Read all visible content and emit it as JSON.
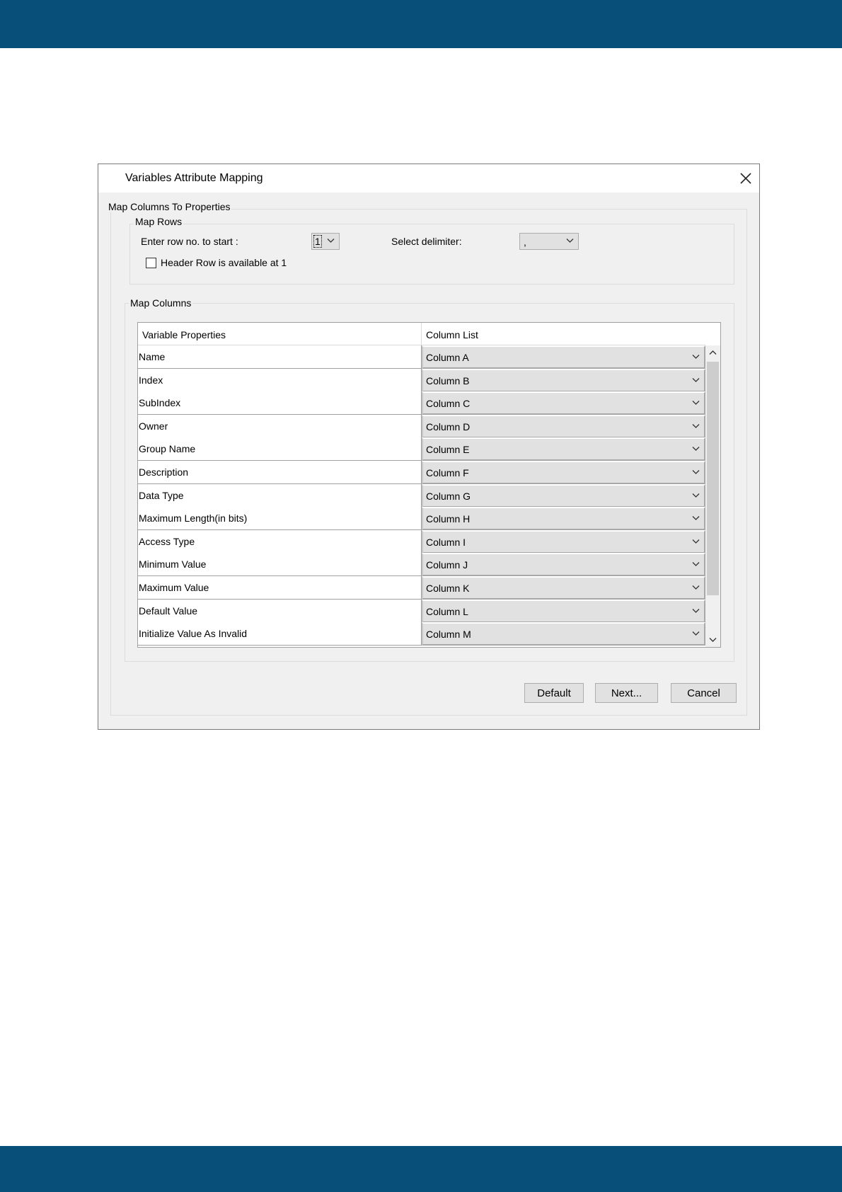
{
  "dialog": {
    "title": "Variables Attribute Mapping",
    "close_icon": "close-icon"
  },
  "map_columns_to_properties": {
    "legend": "Map Columns To Properties"
  },
  "map_rows": {
    "legend": "Map Rows",
    "row_start_label": "Enter row no. to start :",
    "row_start_value": "1",
    "delimiter_label": "Select delimiter:",
    "delimiter_value": ",",
    "header_row_label": "Header Row is available at 1",
    "header_row_checked": false
  },
  "map_columns": {
    "legend": "Map Columns",
    "headers": [
      "Variable Properties",
      "Column List"
    ],
    "rows": [
      {
        "property": "Name",
        "column": "Column A"
      },
      {
        "property": "Index",
        "column": "Column B"
      },
      {
        "property": "SubIndex",
        "column": "Column C"
      },
      {
        "property": "Owner",
        "column": "Column D"
      },
      {
        "property": "Group Name",
        "column": "Column E"
      },
      {
        "property": "Description",
        "column": "Column F"
      },
      {
        "property": "Data Type",
        "column": "Column G"
      },
      {
        "property": "Maximum Length(in bits)",
        "column": "Column H"
      },
      {
        "property": "Access Type",
        "column": "Column I"
      },
      {
        "property": "Minimum Value",
        "column": "Column J"
      },
      {
        "property": "Maximum Value",
        "column": "Column K"
      },
      {
        "property": "Default Value",
        "column": "Column L"
      },
      {
        "property": "Initialize Value As Invalid",
        "column": "Column M"
      }
    ]
  },
  "buttons": {
    "default": "Default",
    "next": "Next...",
    "cancel": "Cancel"
  },
  "colors": {
    "page_band": "#084f7a",
    "dialog_bg": "#f0f0f0"
  }
}
